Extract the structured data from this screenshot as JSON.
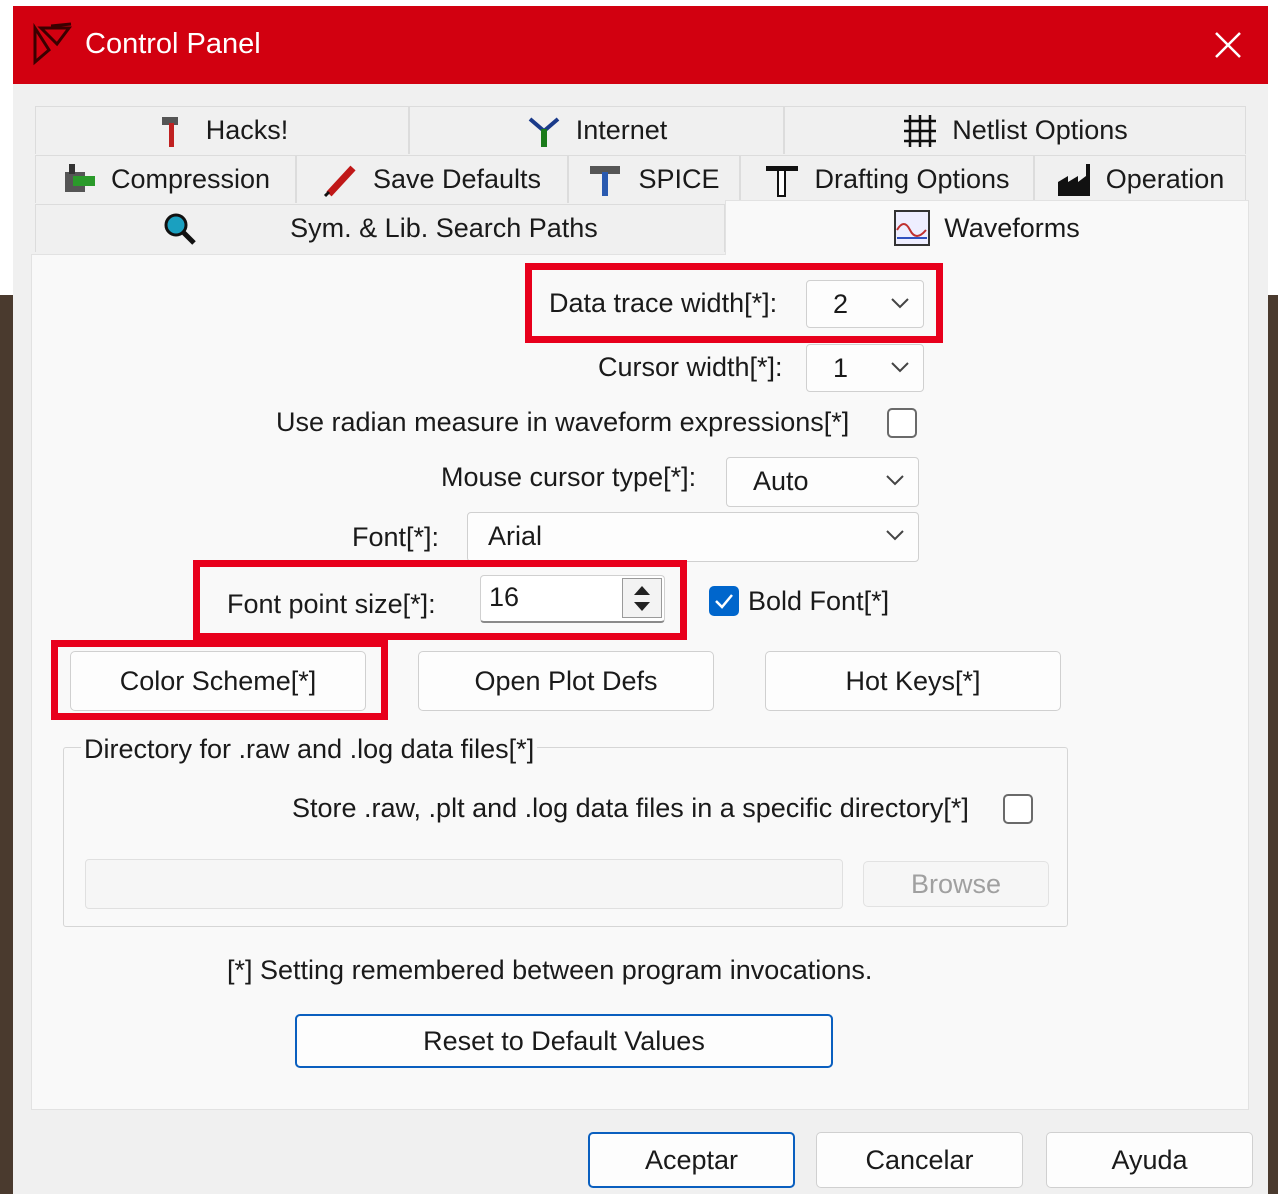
{
  "window": {
    "title": "Control Panel",
    "accent_color": "#d20010"
  },
  "tabs": {
    "row1": [
      {
        "label": "Hacks!",
        "icon": "hammer-icon"
      },
      {
        "label": "Internet",
        "icon": "network-icon"
      },
      {
        "label": "Netlist Options",
        "icon": "netlist-grid-icon"
      }
    ],
    "row2": [
      {
        "label": "Compression",
        "icon": "clamp-icon"
      },
      {
        "label": "Save Defaults",
        "icon": "pen-icon"
      },
      {
        "label": "SPICE",
        "icon": "spice-hammer-icon"
      },
      {
        "label": "Drafting Options",
        "icon": "t-square-icon"
      },
      {
        "label": "Operation",
        "icon": "factory-icon"
      }
    ],
    "row3": [
      {
        "label": "Sym. & Lib. Search Paths",
        "icon": "magnifier-icon"
      },
      {
        "label": "Waveforms",
        "icon": "waveform-icon",
        "active": true
      }
    ]
  },
  "waveforms": {
    "data_trace_width_label": "Data trace width[*]:",
    "data_trace_width_value": "2",
    "cursor_width_label": "Cursor width[*]:",
    "cursor_width_value": "1",
    "radian_label": "Use radian measure in waveform expressions[*]",
    "radian_checked": false,
    "mouse_cursor_label": "Mouse cursor type[*]:",
    "mouse_cursor_value": "Auto",
    "font_label": "Font[*]:",
    "font_value": "Arial",
    "font_size_label": "Font point size[*]:",
    "font_size_value": "16",
    "bold_label": "Bold Font[*]",
    "bold_checked": true,
    "buttons": {
      "color_scheme": "Color Scheme[*]",
      "open_plot_defs": "Open Plot Defs",
      "hot_keys": "Hot Keys[*]"
    },
    "directory_group": {
      "title": "Directory for .raw and .log data files[*]",
      "store_label": "Store .raw, .plt and .log data files in a specific directory[*]",
      "store_checked": false,
      "path_value": "",
      "browse_label": "Browse"
    },
    "note": "[*] Setting remembered between program invocations.",
    "reset_label": "Reset to Default Values"
  },
  "footer": {
    "ok_label": "Aceptar",
    "cancel_label": "Cancelar",
    "help_label": "Ayuda"
  },
  "highlight_color": "#e8001c"
}
